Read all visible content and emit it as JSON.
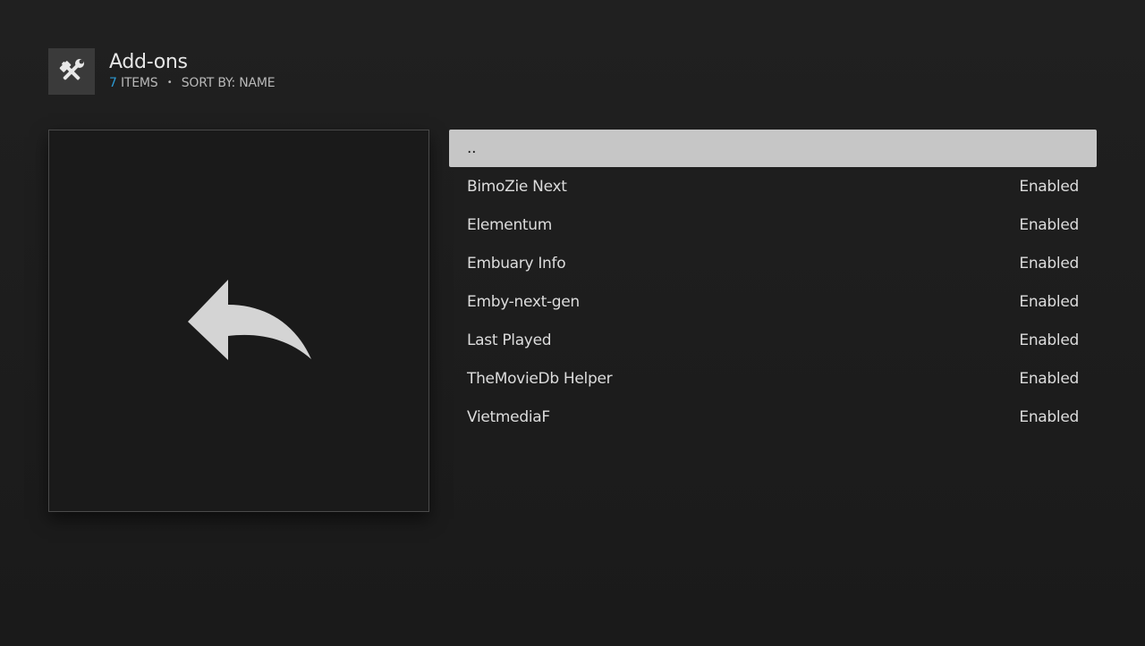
{
  "header": {
    "title": "Add-ons",
    "item_count": "7",
    "items_label": "ITEMS",
    "separator": "•",
    "sort_label": "SORT BY: NAME",
    "icon": "tools-icon"
  },
  "preview": {
    "icon": "back-arrow-icon"
  },
  "list": {
    "parent": "..",
    "items": [
      {
        "name": "BimoZie Next",
        "status": "Enabled"
      },
      {
        "name": "Elementum",
        "status": "Enabled"
      },
      {
        "name": "Embuary Info",
        "status": "Enabled"
      },
      {
        "name": "Emby-next-gen",
        "status": "Enabled"
      },
      {
        "name": "Last Played",
        "status": "Enabled"
      },
      {
        "name": "TheMovieDb Helper",
        "status": "Enabled"
      },
      {
        "name": "VietmediaF",
        "status": "Enabled"
      }
    ]
  },
  "colors": {
    "accent": "#2b9ad4",
    "selected_bg": "#c6c6c6",
    "background": "#1c1c1c"
  }
}
